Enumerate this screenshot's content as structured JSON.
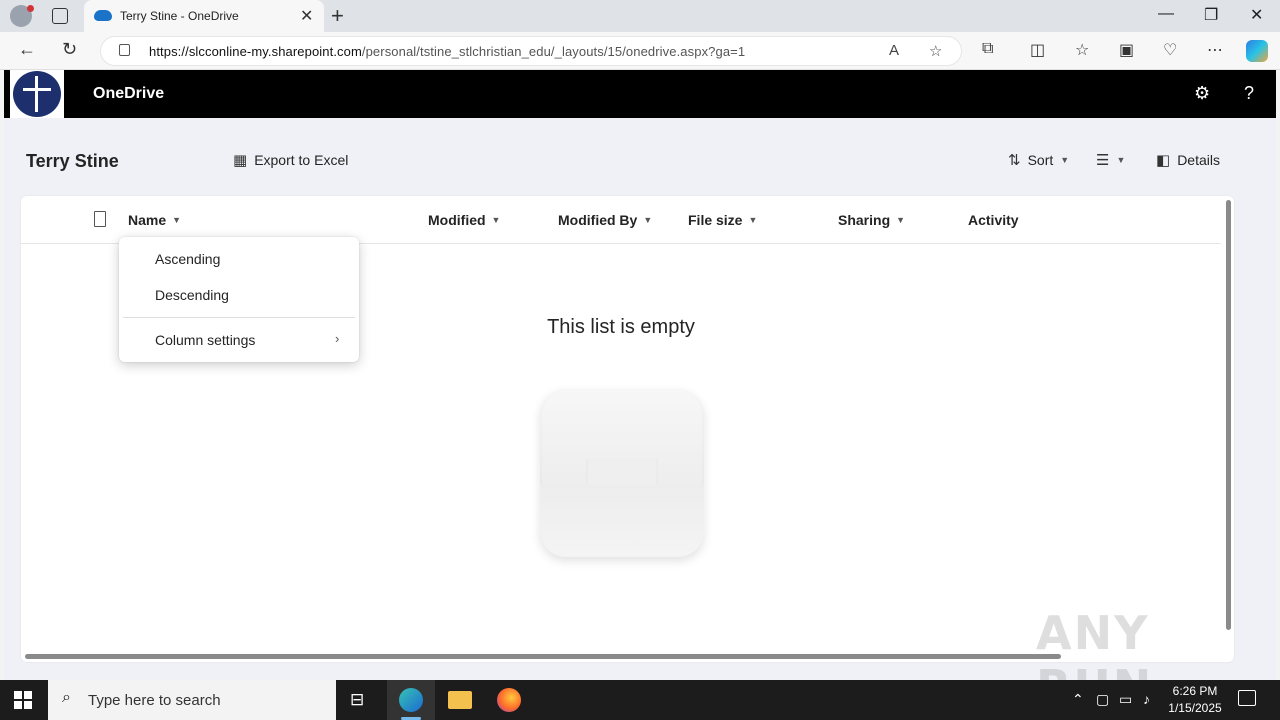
{
  "browser": {
    "tab_title": "Terry Stine - OneDrive",
    "url_host": "https://slcconline-my.sharepoint.com",
    "url_path": "/personal/tstine_stlchristian_edu/_layouts/15/onedrive.aspx?ga=1"
  },
  "app": {
    "name": "OneDrive"
  },
  "commandbar": {
    "title": "Terry Stine",
    "export_label": "Export to Excel",
    "sort_label": "Sort",
    "details_label": "Details"
  },
  "columns": [
    "Name",
    "Modified",
    "Modified By",
    "File size",
    "Sharing",
    "Activity"
  ],
  "empty_state": {
    "message": "This list is empty"
  },
  "context_menu": {
    "items": [
      "Ascending",
      "Descending",
      "Column settings"
    ]
  },
  "watermark": "ANY RUN",
  "taskbar": {
    "search_placeholder": "Type here to search",
    "time": "6:26 PM",
    "date": "1/15/2025"
  },
  "colors": {
    "suitebar": "#000000",
    "app_background": "#f0f1f6",
    "taskbar": "#1c1c1c",
    "logo_blue": "#1e2f6e"
  }
}
